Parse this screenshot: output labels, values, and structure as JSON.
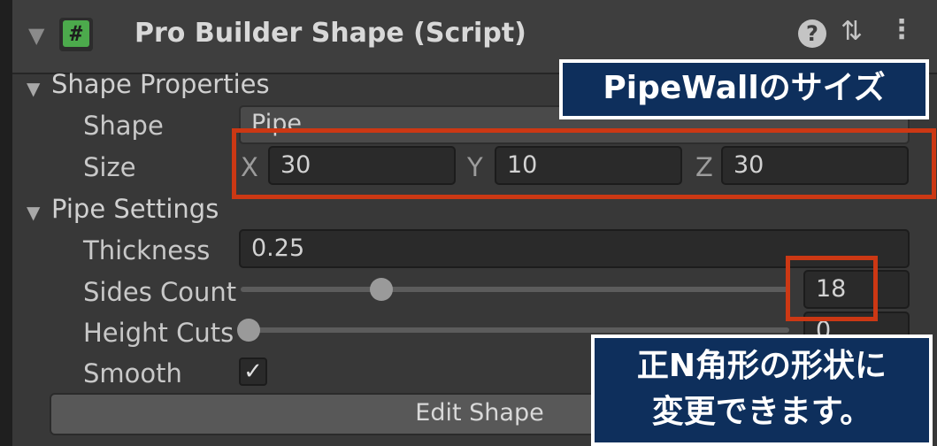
{
  "header": {
    "title": "Pro Builder Shape (Script)",
    "icon_glyph": "#",
    "help_glyph": "?",
    "presets_glyph": "⇅",
    "menu_glyph": "⋮"
  },
  "shape_properties": {
    "label": "Shape Properties",
    "shape_label": "Shape",
    "shape_value": "Pipe",
    "size_label": "Size",
    "size": {
      "x_label": "X",
      "x": "30",
      "y_label": "Y",
      "y": "10",
      "z_label": "Z",
      "z": "30"
    }
  },
  "pipe_settings": {
    "label": "Pipe Settings",
    "thickness_label": "Thickness",
    "thickness": "0.25",
    "sides_label": "Sides Count",
    "sides": "18",
    "height_cuts_label": "Height Cuts",
    "height_cuts": "0",
    "smooth_label": "Smooth",
    "smooth_checked": "✓"
  },
  "edit_shape_label": "Edit Shape",
  "annotations": {
    "callout_top": "PipeWallのサイズ",
    "callout_bottom_line1": "正N角形の形状に",
    "callout_bottom_line2": "変更できます。"
  },
  "colors": {
    "accent_red": "#cc3814",
    "callout_bg": "#0e2f5c"
  }
}
